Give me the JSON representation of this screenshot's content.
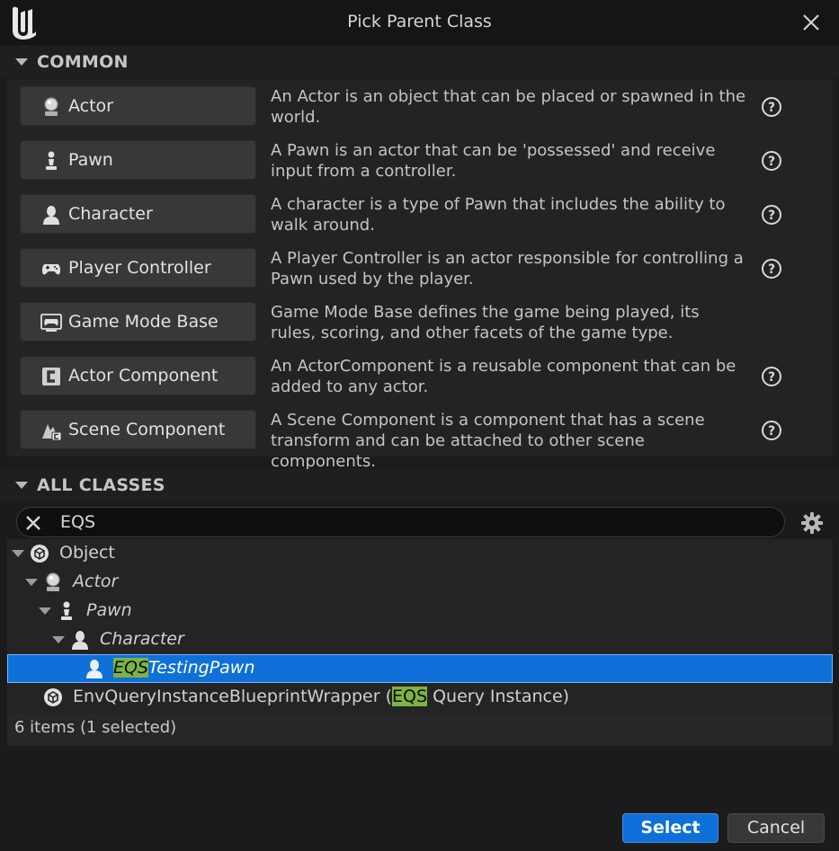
{
  "window": {
    "title": "Pick Parent Class"
  },
  "sections": {
    "common": "COMMON",
    "all_classes": "ALL CLASSES"
  },
  "common": [
    {
      "label": "Actor",
      "icon": "actor-icon",
      "desc": "An Actor is an object that can be placed or spawned in the world.",
      "help": true
    },
    {
      "label": "Pawn",
      "icon": "pawn-icon",
      "desc": "A Pawn is an actor that can be 'possessed' and receive input from a controller.",
      "help": true
    },
    {
      "label": "Character",
      "icon": "character-icon",
      "desc": "A character is a type of Pawn that includes the ability to walk around.",
      "help": true
    },
    {
      "label": "Player Controller",
      "icon": "gamepad-icon",
      "desc": "A Player Controller is an actor responsible for controlling a Pawn used by the player.",
      "help": true
    },
    {
      "label": "Game Mode Base",
      "icon": "game-mode-icon",
      "desc": "Game Mode Base defines the game being played, its rules, scoring, and other facets of the game type.",
      "help": false
    },
    {
      "label": "Actor Component",
      "icon": "actor-component-icon",
      "desc": "An ActorComponent is a reusable component that can be added to any actor.",
      "help": true
    },
    {
      "label": "Scene Component",
      "icon": "scene-component-icon",
      "desc": "A Scene Component is a component that has a scene transform and can be attached to other scene components.",
      "help": true
    }
  ],
  "search": {
    "value": "EQS"
  },
  "tree": [
    {
      "label": "Object",
      "italic": false,
      "icon": "object-icon"
    },
    {
      "label": "Actor",
      "italic": true,
      "icon": "actor-icon"
    },
    {
      "label": "Pawn",
      "italic": true,
      "icon": "pawn-icon"
    },
    {
      "label": "Character",
      "italic": true,
      "icon": "character-icon"
    },
    {
      "match": "EQS",
      "rest": "TestingPawn",
      "italic": true,
      "selected": true,
      "icon": "character-icon"
    },
    {
      "pre": "EnvQueryInstanceBlueprintWrapper (",
      "match": "EQS",
      "post": " Query Instance)",
      "italic": false,
      "icon": "object-icon"
    }
  ],
  "status": "6 items (1 selected)",
  "buttons": {
    "select": "Select",
    "cancel": "Cancel"
  },
  "colors": {
    "accent": "#0e70d8",
    "highlight": "#7cb342"
  }
}
